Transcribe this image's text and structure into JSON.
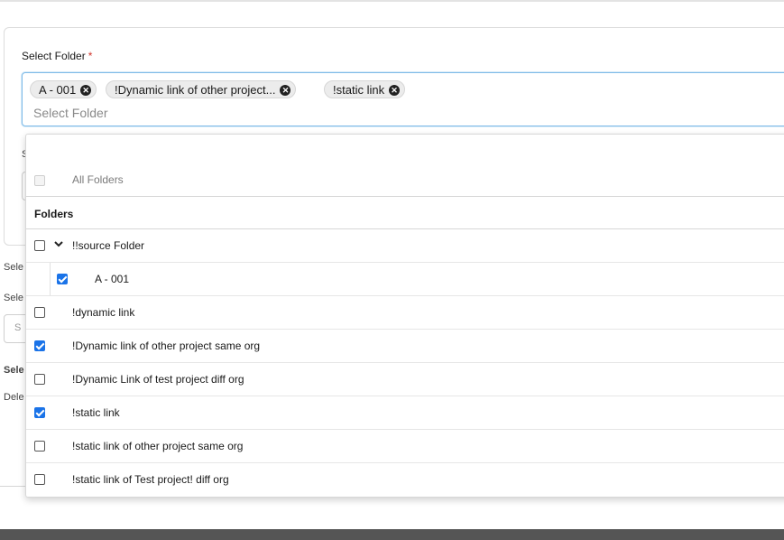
{
  "field": {
    "label": "Select Folder",
    "required_mark": "*",
    "placeholder": "Select Folder"
  },
  "chips": [
    {
      "label": "A - 001"
    },
    {
      "label": "!Dynamic link of other project..."
    },
    {
      "label": "!static link"
    }
  ],
  "background_fragments": [
    "S",
    "Sele",
    "Sele",
    "S",
    "Sele",
    "Dele"
  ],
  "dropdown": {
    "all_folders_label": "All Folders",
    "all_folders_checked": false,
    "folders_heading": "Folders",
    "rows": [
      {
        "label": "!!source Folder",
        "checked": false,
        "expanded": true,
        "level": 0
      },
      {
        "label": "A - 001",
        "checked": true,
        "level": 1
      },
      {
        "label": "!dynamic link",
        "checked": false,
        "level": 0
      },
      {
        "label": "!Dynamic link of other project same org",
        "checked": true,
        "level": 0
      },
      {
        "label": "!Dynamic Link of test project diff org",
        "checked": false,
        "level": 0
      },
      {
        "label": "!static link",
        "checked": true,
        "level": 0
      },
      {
        "label": "!static link of other project same org",
        "checked": false,
        "level": 0
      },
      {
        "label": "!static link of Test project! diff org",
        "checked": false,
        "level": 0
      }
    ]
  },
  "icons": {
    "chip_remove": "close-icon",
    "expand": "chevron-down-icon"
  },
  "colors": {
    "accent": "#1a73e8",
    "required": "#d0342c",
    "focus_border": "#7fbbe8"
  }
}
